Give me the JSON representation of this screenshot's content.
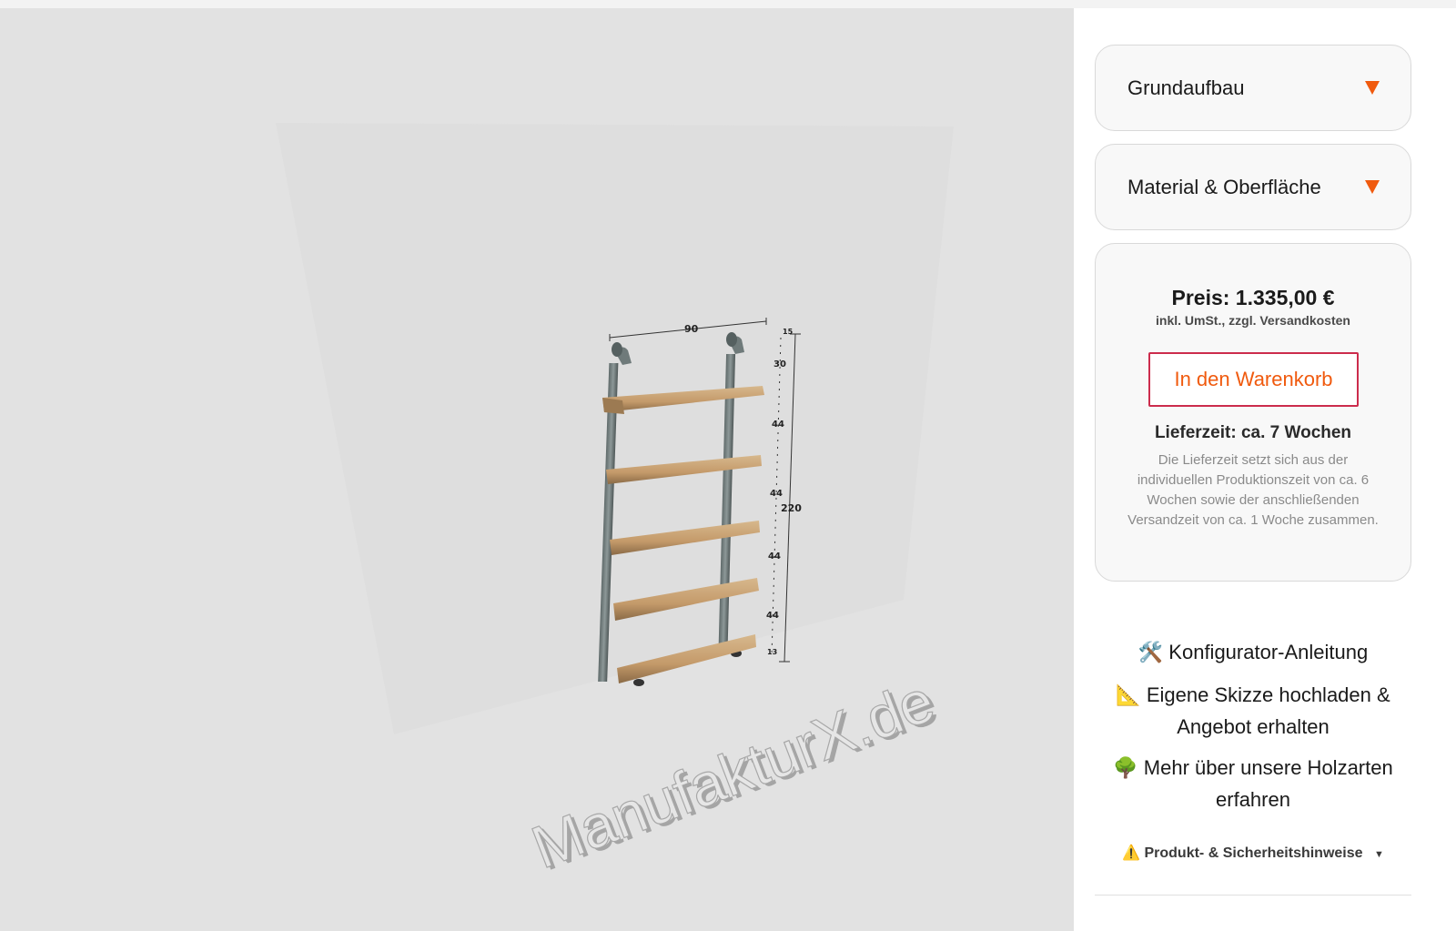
{
  "viewer": {
    "watermark": "ManufakturX.de",
    "dimensions": {
      "width": "90",
      "top_offset": "15",
      "segments": [
        "30",
        "44",
        "44",
        "44",
        "44",
        "13"
      ],
      "total_height": "220"
    }
  },
  "sidebar": {
    "accordions": [
      {
        "label": "Grundaufbau"
      },
      {
        "label": "Material & Oberfläche"
      }
    ],
    "price_card": {
      "price": "Preis: 1.335,00 €",
      "price_note": "inkl. UmSt., zzgl. Versandkosten",
      "cart_button": "In den Warenkorb",
      "delivery_title": "Lieferzeit: ca. 7 Wochen",
      "delivery_note": "Die Lieferzeit setzt sich aus der individuellen Produktionszeit von ca. 6 Wochen sowie der anschließenden Versandzeit von ca. 1 Woche zusammen."
    },
    "links": [
      {
        "icon": "🛠️",
        "text": "Konfigurator-Anleitung"
      },
      {
        "icon": "📐",
        "text": "Eigene Skizze hochladen & Angebot erhalten"
      },
      {
        "icon": "🌳",
        "text": "Mehr über unsere Holzarten erfahren"
      }
    ],
    "hint": {
      "icon": "⚠️",
      "text": "Produkt- & Sicherheitshinweise"
    }
  },
  "colors": {
    "accent": "#f05a0e",
    "button_border": "#cc2c4c"
  }
}
